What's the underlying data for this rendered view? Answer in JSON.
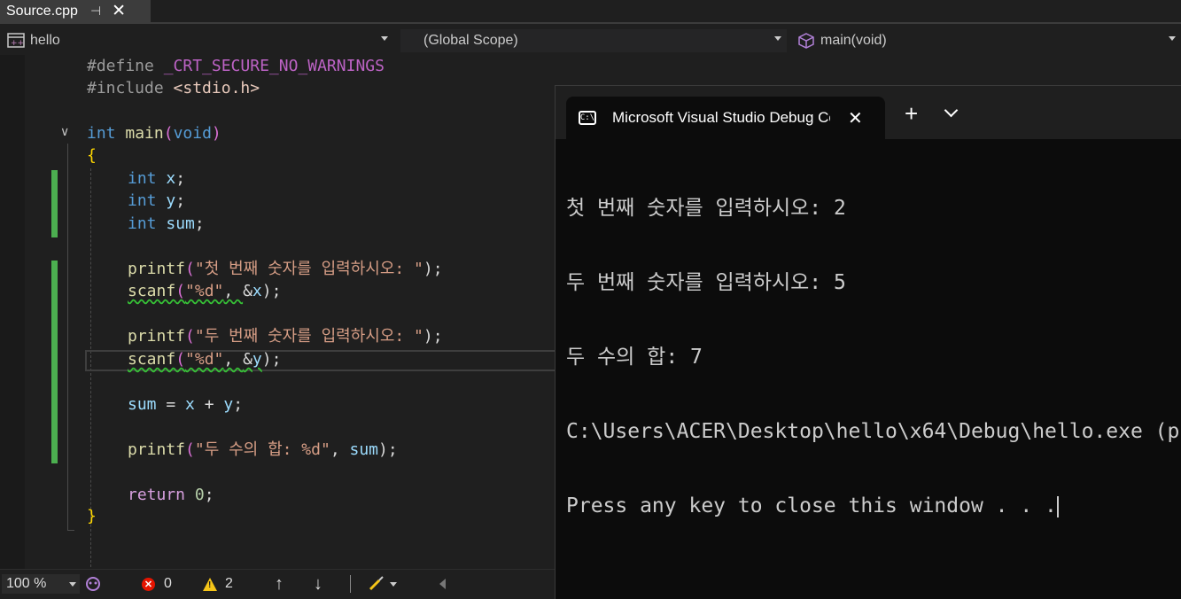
{
  "tab": {
    "title": "Source.cpp",
    "pin": "⊣",
    "close": "✕"
  },
  "navbar": {
    "project": "hello",
    "scope": "(Global Scope)",
    "member": "main(void)"
  },
  "code": {
    "l1": [
      "#define",
      " ",
      "_CRT_SECURE_NO_WARNINGS"
    ],
    "l2": [
      "#include",
      " ",
      "<stdio.h>"
    ],
    "l4": [
      "int",
      " ",
      "main",
      "(",
      "void",
      ")"
    ],
    "l5": "{",
    "l6": [
      "int",
      " ",
      "x",
      ";"
    ],
    "l7": [
      "int",
      " ",
      "y",
      ";"
    ],
    "l8": [
      "int",
      " ",
      "sum",
      ";"
    ],
    "l10": [
      "printf",
      "(",
      "\"첫 번째 숫자를 입력하시오: \"",
      ");"
    ],
    "l11": [
      "scanf",
      "(",
      "\"%d\"",
      ", ",
      "&",
      "x",
      ");"
    ],
    "l13": [
      "printf",
      "(",
      "\"두 번째 숫자를 입력하시오: \"",
      ");"
    ],
    "l14": [
      "scanf",
      "(",
      "\"%d\"",
      ", ",
      "&",
      "y",
      ");"
    ],
    "l16": [
      "sum",
      " = ",
      "x",
      " + ",
      "y",
      ";"
    ],
    "l18": [
      "printf",
      "(",
      "\"두 수의 합: %d\"",
      ", ",
      "sum",
      ");"
    ],
    "l20": [
      "return",
      " ",
      "0",
      ";"
    ],
    "l21": "}"
  },
  "statusbar": {
    "zoom": "100 %",
    "errors": "0",
    "warnings": "2"
  },
  "terminal": {
    "title": "Microsoft Visual Studio Debug Console",
    "icon_text": "C:\\",
    "lines": [
      "첫 번째 숫자를 입력하시오: 2",
      "두 번째 숫자를 입력하시오: 5",
      "두 수의 합: 7",
      "C:\\Users\\ACER\\Desktop\\hello\\x64\\Debug\\hello.exe (p",
      "Press any key to close this window . . ."
    ]
  },
  "colors": {
    "keyword": "#569cd6",
    "function": "#dcdcaa",
    "string": "#d69d85",
    "variable": "#9cdcfe",
    "change_bar": "#4caf50",
    "error": "#e51400",
    "warning": "#f5c518"
  },
  "icons": {
    "project": "cpp-project-icon",
    "member": "function-cube-icon",
    "git": "copilot-icon",
    "cleanup": "brush-icon",
    "up": "arrow-up-icon",
    "down": "arrow-down-icon"
  }
}
